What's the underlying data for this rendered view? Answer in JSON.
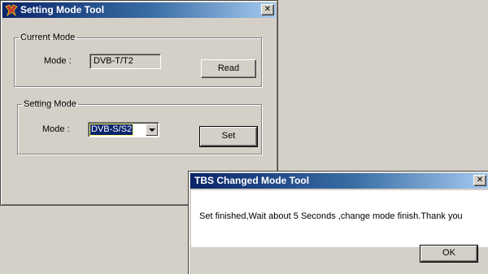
{
  "main_window": {
    "title": "Setting Mode Tool",
    "close_label": "✕",
    "current_mode": {
      "group_label": "Current Mode",
      "mode_label": "Mode :",
      "value": "DVB-T/T2",
      "read_button": "Read"
    },
    "setting_mode": {
      "group_label": "Setting Mode",
      "mode_label": "Mode :",
      "selected": "DVB-S/S2",
      "set_button": "Set"
    }
  },
  "dialog": {
    "title": "TBS Changed Mode Tool",
    "close_label": "✕",
    "message": "Set finished,Wait about 5 Seconds ,change mode finish.Thank you",
    "ok_button": "OK"
  },
  "colors": {
    "title_start": "#0a246a",
    "title_end": "#a6caf0",
    "face": "#d4d0c8",
    "selection": "#0a246a"
  }
}
